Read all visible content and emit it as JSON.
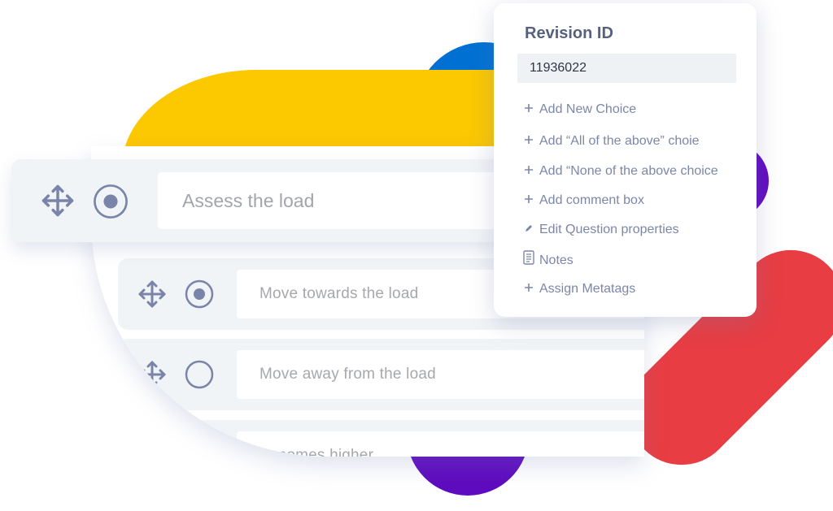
{
  "menu": {
    "title": "Revision ID",
    "revision_id": "11936022",
    "items": [
      {
        "icon": "plus-icon",
        "label": "Add New Choice"
      },
      {
        "icon": "plus-icon",
        "label": "Add “All of the above” choie"
      },
      {
        "icon": "plus-icon",
        "label": "Add “None of the above choice"
      },
      {
        "icon": "plus-icon",
        "label": "Add comment box"
      },
      {
        "icon": "pencil-icon",
        "label": "Edit Question properties"
      },
      {
        "icon": "notes-icon",
        "label": "Notes"
      },
      {
        "icon": "plus-icon",
        "label": "Assign Metatags"
      }
    ]
  },
  "question": {
    "text": "Assess the load",
    "selected": true
  },
  "choices": [
    {
      "text": "Move towards the load",
      "selected": true
    },
    {
      "text": "Move away from the load",
      "selected": false
    },
    {
      "text": "Becomes higher",
      "selected": false
    }
  ],
  "colors": {
    "yellow": "#fcc800",
    "blue": "#0070d2",
    "purple": "#5f0bbf",
    "red": "#e83d43",
    "icon": "#7a84a8"
  }
}
